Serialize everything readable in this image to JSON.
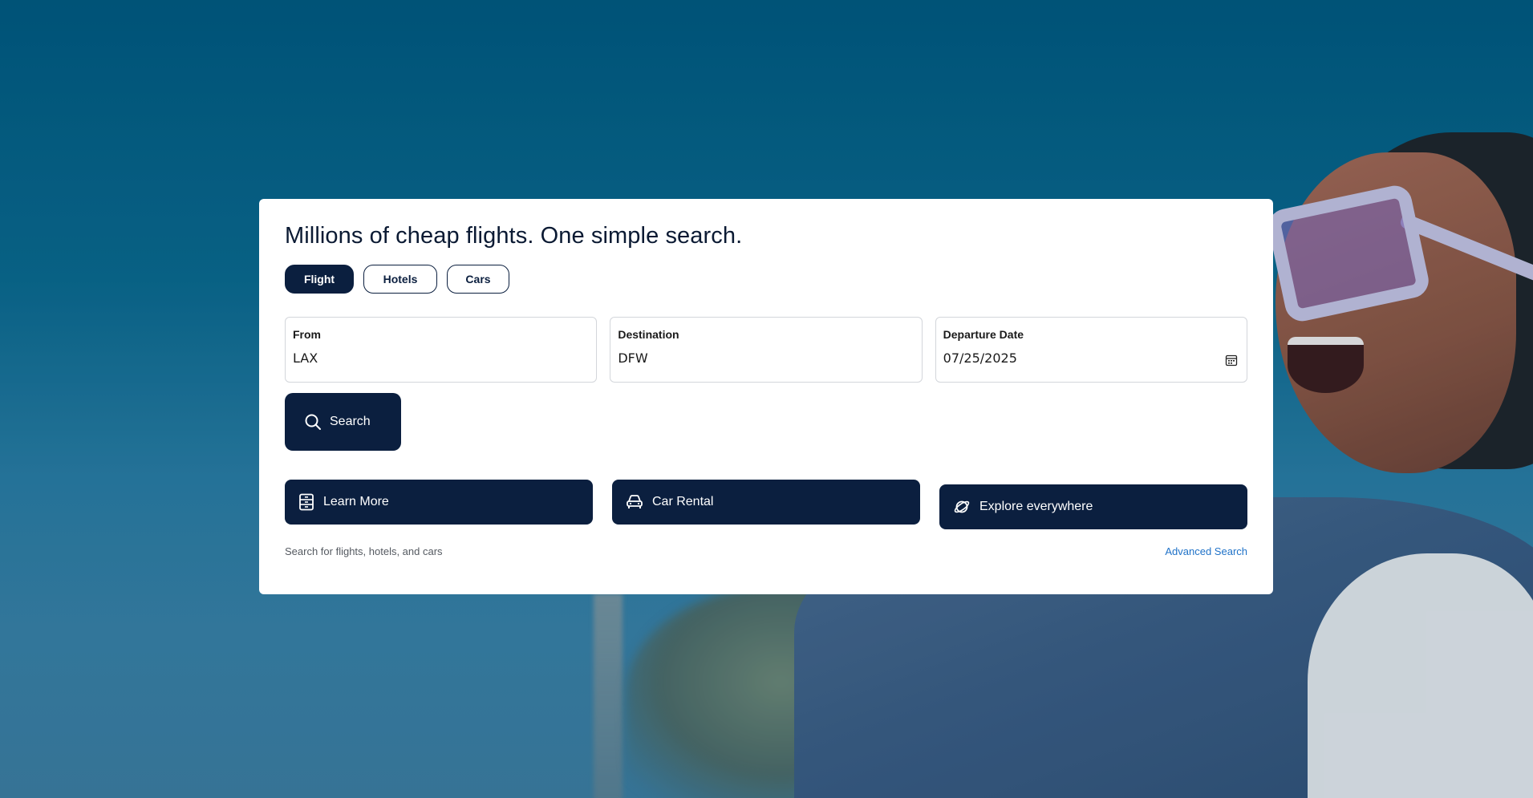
{
  "card": {
    "headline": "Millions of cheap flights. One simple search.",
    "tabs": [
      {
        "label": "Flight",
        "active": true
      },
      {
        "label": "Hotels",
        "active": false
      },
      {
        "label": "Cars",
        "active": false
      }
    ],
    "fields": {
      "from": {
        "label": "From",
        "value": "LAX"
      },
      "destination": {
        "label": "Destination",
        "value": "DFW"
      },
      "departure": {
        "label": "Departure Date",
        "value": "07/25/2025",
        "icon": "calendar-icon"
      }
    },
    "search_button": {
      "label": "Search",
      "icon": "search-icon"
    },
    "actions": [
      {
        "label": "Learn More",
        "icon": "document-icon"
      },
      {
        "label": "Car Rental",
        "icon": "car-icon"
      },
      {
        "label": "Explore everywhere",
        "icon": "planet-icon"
      }
    ],
    "footer": {
      "hint": "Search for flights, hotels, and cars",
      "advanced_link": "Advanced Search"
    }
  },
  "colors": {
    "primary": "#0b1f3f",
    "link": "#1f72c8",
    "background_sky": "#005a80"
  }
}
